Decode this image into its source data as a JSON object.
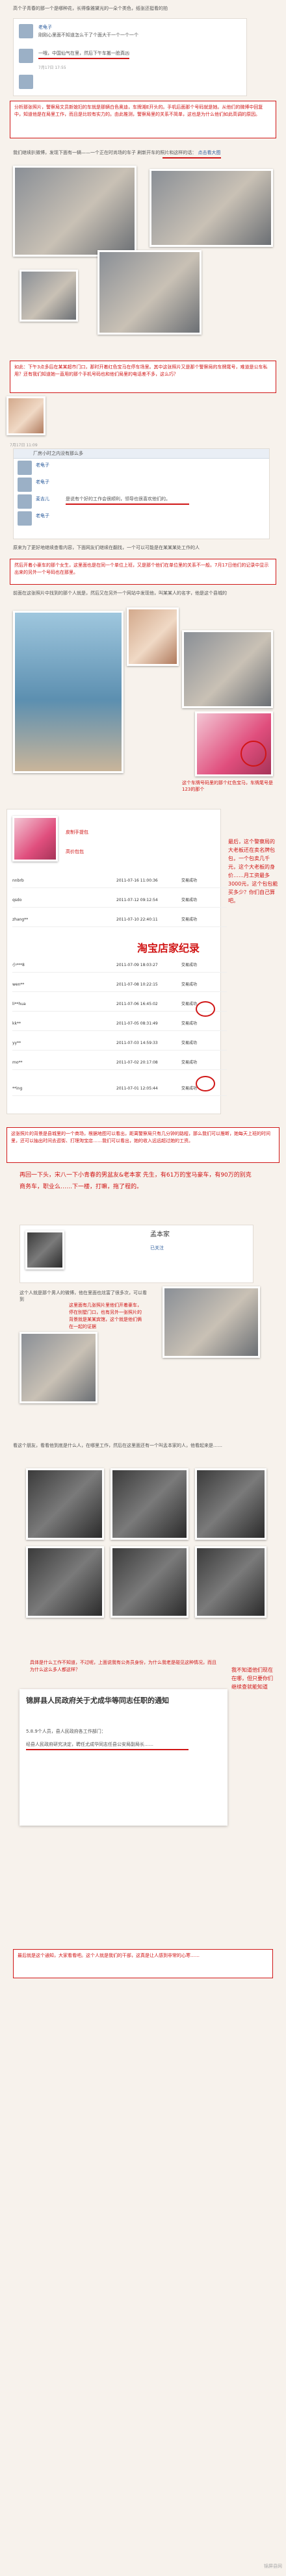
{
  "intro": "高个子青春的那一个是哪种花，长得像雅黛光的一朵个类色，纸张还挺看的拍",
  "post1": {
    "user": "老龟子",
    "text1": "刚刚心里面不知道怎么干了个面大干一个一个一个",
    "text2": "一哦，中国仙气在里，然后下午车搬一脸真凶",
    "time": "7月17日 17:55"
  },
  "note1": "分析那张照片，警察局文员新媳妇的车就是那辆白色奥迪，车牌湘E开头的。手机后面那个号码就是她。从他们的微博中回复中，知道他是在局里工作，而且是比较有实力的。由此推测，警察局里的关系不简单，这也是为什么他们如此高调的原因。",
  "post2": {
    "intro": "我们继续扒微博，发现下面有一辆——一个正在时尚场的车子 刷新开车的照片和这样的话：",
    "link": "点击看大图"
  },
  "note2": "如此：下午3点多后在某某超市门口，那时开着红色宝马在停车场里。其中这张照片又是那个警察局的车牌尾号，难道是公车私用？还有我们知道她一直用的那个手机号码也和他们局里的电话差不多，这么巧？",
  "post3": {
    "header": "厂房小时之内没有那么多",
    "time": "7月17日 11:09",
    "users": [
      "老龟子",
      "老龟子",
      "老龟子",
      "麦吉儿"
    ],
    "highlight": "是说有个好的工作会很顺利，领导也很喜欢他们的。",
    "footer": "原来为了更好地继续查看内容，下面网友们继续在翻找，一个可以可能是在某某某处工作的人"
  },
  "note3": "然后开着小豪车的那个女生，这里面也是在同一个单位上班，又是那个他们在单位里的关系不一般。7月17日他们的记录中显示出来的另外一个号码也在那里。",
  "post4": {
    "text": "前面在这张照片中找到的那个人就是，然后又在另外一个网站中发现他，叫某某人的名字，他是这个县城的"
  },
  "photos_caption": "这个车牌号码里的那个红色宝马，车牌尾号是123的那个",
  "shop": {
    "title": "淘宝店家纪录",
    "label_a": "皮制手提包",
    "label_b": "高价包包",
    "note": "最后，这个警察局的大老板还在卖名牌包包，一个包卖几千元，这个大老板的身价……月工资最多3000元，这个包包能买多少？你们自己算吧。",
    "rows": [
      {
        "user": "nnbrb",
        "date": "2011-07-16 11:00:36",
        "status": "交易成功"
      },
      {
        "user": "qsdo",
        "date": "2011-07-12 09:12:54",
        "status": "交易成功"
      },
      {
        "user": "zhang**",
        "date": "2011-07-10 22:40:11",
        "status": "交易成功"
      },
      {
        "user": "小***8",
        "date": "2011-07-09 18:03:27",
        "status": "交易成功"
      },
      {
        "user": "wen**",
        "date": "2011-07-08 10:22:15",
        "status": "交易成功"
      },
      {
        "user": "li**hua",
        "date": "2011-07-06 16:45:02",
        "status": "交易成功"
      },
      {
        "user": "kk**",
        "date": "2011-07-05 08:31:49",
        "status": "交易成功"
      },
      {
        "user": "yy**",
        "date": "2011-07-03 14:59:33",
        "status": "交易成功"
      },
      {
        "user": "mo**",
        "date": "2011-07-02 20:17:08",
        "status": "交易成功"
      },
      {
        "user": "**ing",
        "date": "2011-07-01 12:05:44",
        "status": "交易成功"
      }
    ]
  },
  "note4": "这张照片的背景是县城里的一个商场，根据地图可以看出，距离警察局只有几分钟的路程，那么我们可以推断，她每天上班的时间里，还可以抽出时间去逛街、打理淘宝店……我们可以看出，她的收入远远超过她的工资。",
  "handwritten": "再回一下头，宋八一下小青春的男盆友&老本家 先生，有61万的宝马豪车，有90万的别克商务车，职业么……下一楼，打嘛，拖了程的。",
  "profile": {
    "name": "孟本家",
    "status": "已关注",
    "text": "这个人就是那个男人的微博，他在里面也炫富了很多次，可以看到"
  },
  "note5": "这里面有几张照片里他们开着豪车，停在别墅门口，也有另外一张照片的背景就是某某宾馆，这个就是他们俩在一起的证据",
  "post5": {
    "text": "看这个朋友，看看他到底是什么人，在哪里工作，然后在这里面还有一个叫孟本家的人，他看起来是……"
  },
  "note6": "具体是什么工作不知道，不过呢，上面说我有公务员身份，为什么我老是碰见这种情况，而且为什么这么多人都这样？",
  "side_note": "我不知道他们现在在哪，但只要你们继续查就能知道",
  "doc": {
    "title": "锦屏县人民政府关于尤成华等同志任职的通知",
    "subtitle": "5.8.9个人员，县人民政府各工作部门：",
    "para": "经县人民政府研究决定，聘任尤成华同志任县公安局副局长……"
  },
  "closing": "最后就是这个通知，大家看看吧。这个人就是我们的干部，这真是让人感到非常的心寒……",
  "watermark": "锦屏县网"
}
